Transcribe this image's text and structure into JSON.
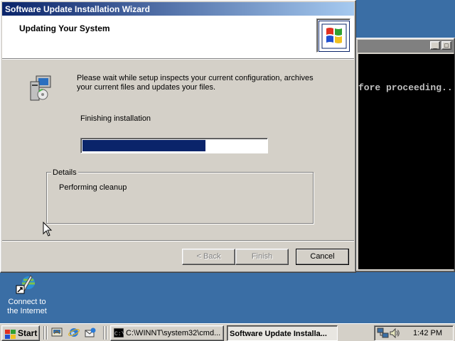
{
  "desktop": {
    "icons": [
      {
        "label": "Connect to the Internet",
        "icon": "connect-internet-icon"
      }
    ]
  },
  "console": {
    "title": "",
    "text": "fore proceeding.."
  },
  "wizard": {
    "title": "Software Update Installation Wizard",
    "header_title": "Updating Your System",
    "intro": "Please wait while setup inspects your current configuration, archives your current files and updates your files.",
    "status": "Finishing installation",
    "progress": 0.67,
    "details_legend": "Details",
    "details_text": "Performing cleanup",
    "buttons": {
      "back": "< Back",
      "finish": "Finish",
      "cancel": "Cancel"
    }
  },
  "taskbar": {
    "start_label": "Start",
    "quick_launch": [
      "desktop-icon",
      "ie-icon",
      "outlook-icon"
    ],
    "tasks": [
      {
        "label": "C:\\WINNT\\system32\\cmd...",
        "active": false
      },
      {
        "label": "Software Update Installa...",
        "active": true
      }
    ],
    "clock": "1:42 PM"
  },
  "colors": {
    "desktop": "#3a6ea5",
    "titlebar": "#0a246a",
    "face": "#d4d0c8",
    "progress": "#0a246a"
  }
}
